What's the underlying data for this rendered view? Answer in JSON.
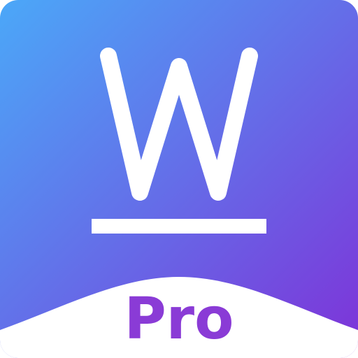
{
  "app_icon": {
    "letter": "W",
    "badge_text": "Pro",
    "colors": {
      "gradient_start": "#4BA8F8",
      "gradient_end": "#7E32D8",
      "letter": "#FFFFFF",
      "underline": "#FFFFFF",
      "wave": "#FFFFFF",
      "badge_text": "#8A3BD6"
    }
  }
}
